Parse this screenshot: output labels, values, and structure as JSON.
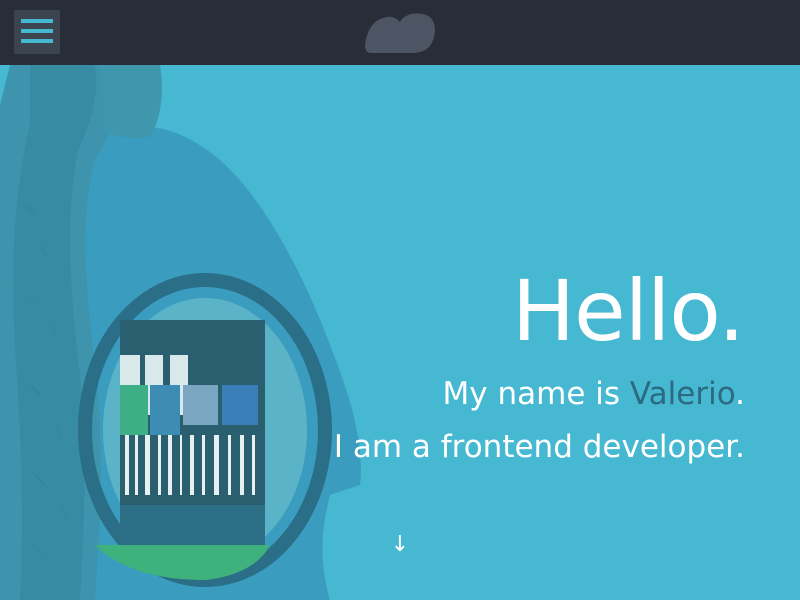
{
  "header": {
    "menu_icon": "hamburger-menu-icon",
    "logo_icon": "cloud-logo-icon",
    "accent_color": "#47b8d1",
    "background_color": "#282d37"
  },
  "hero": {
    "heading": "Hello.",
    "intro_prefix": "My name is ",
    "intro_name": "Valerio",
    "intro_suffix": ".",
    "tagline": "I am a frontend developer.",
    "scroll_icon": "down-arrow-icon",
    "scroll_glyph": "↓",
    "background_color": "#47b8d1",
    "name_color": "#2c6a80"
  }
}
